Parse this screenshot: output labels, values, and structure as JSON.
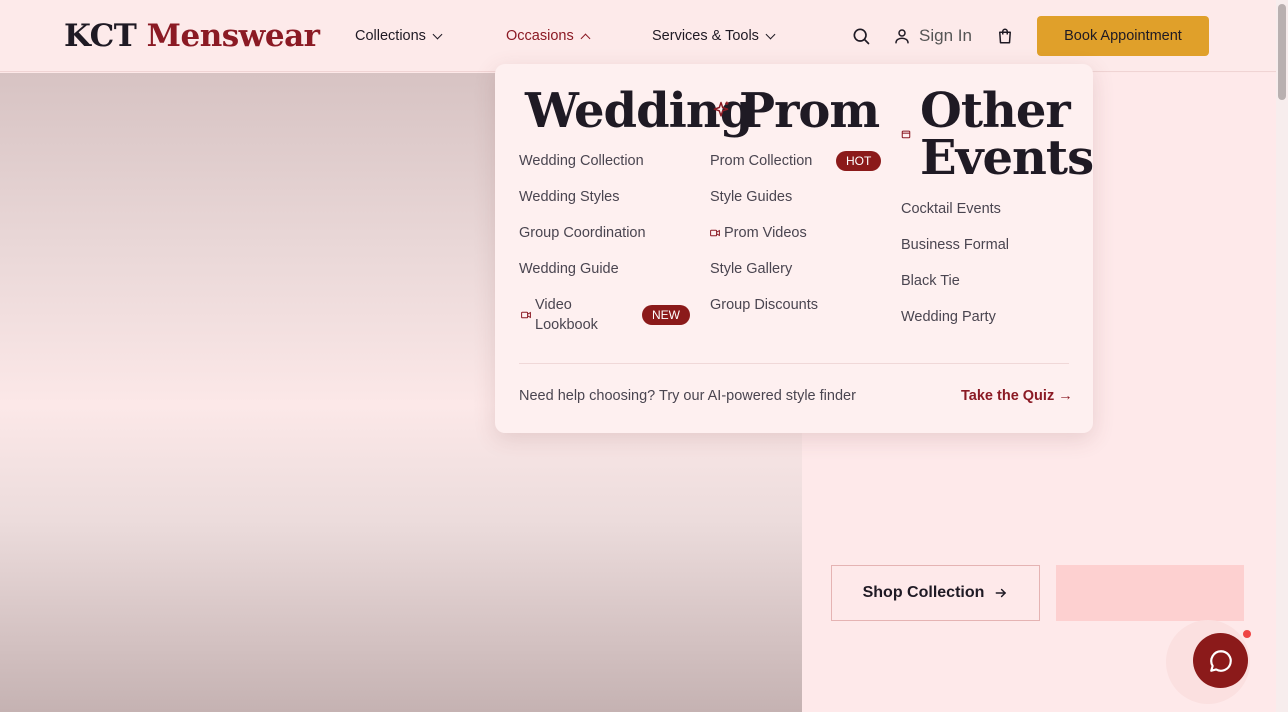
{
  "brand": {
    "name_part1": "KCT",
    "name_part2": "Menswear"
  },
  "nav": {
    "collections": "Collections",
    "occasions": "Occasions",
    "services": "Services & Tools"
  },
  "header": {
    "sign_in": "Sign In",
    "book_appointment": "Book Appointment",
    "icons": {
      "search": "search-icon",
      "user": "user-icon",
      "cart": "shopping-bag-icon"
    }
  },
  "mega_menu": {
    "wedding": {
      "heading": "Wedding",
      "links": [
        "Wedding Collection",
        "Wedding Styles",
        "Group Coordination",
        "Wedding Guide"
      ],
      "video_link": {
        "line1": "Video",
        "line2": "Lookbook",
        "badge": "NEW"
      }
    },
    "prom": {
      "heading": "Prom",
      "icon": "sparkles-icon",
      "collection": {
        "label": "Prom Collection",
        "badge": "HOT"
      },
      "links": [
        "Style Guides",
        "Prom Videos",
        "Style Gallery",
        "Group Discounts"
      ]
    },
    "other": {
      "heading_line1": "Other",
      "heading_line2": "Events",
      "icon": "calendar-icon",
      "links": [
        "Cocktail Events",
        "Business Formal",
        "Black Tie",
        "Wedding Party"
      ]
    },
    "footer": {
      "help_text": "Need help choosing? Try our AI-powered style finder",
      "quiz_link": "Take the Quiz →"
    }
  },
  "hero": {
    "shop_button": "Shop Collection",
    "secondary_button": ""
  },
  "colors": {
    "accent": "#8b1a24",
    "gold": "#e0a02a",
    "background": "#fde8e8"
  }
}
